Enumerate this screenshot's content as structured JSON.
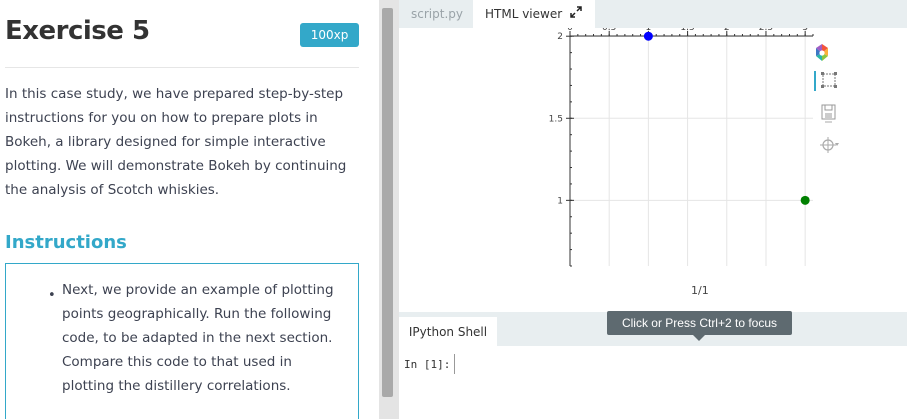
{
  "exercise": {
    "title": "Exercise 5",
    "xp": "100xp",
    "body": "In this case study, we have prepared step-by-step instructions for you on how to prepare plots in Bokeh, a library designed for simple interactive plotting. We will demonstrate Bokeh by continuing the analysis of Scotch whiskies."
  },
  "instructions": {
    "heading": "Instructions",
    "bullet": "•",
    "items": [
      "Next, we provide an example of plotting points geographically. Run the following code, to be adapted in the next section. Compare this code to that used in plotting the distillery correlations."
    ]
  },
  "tabs": {
    "script": "script.py",
    "html_viewer": "HTML viewer",
    "expand_icon": "expand-arrows-icon"
  },
  "viewer": {
    "page_indicator": "1/1"
  },
  "bokeh_toolbar": {
    "icons": [
      "bokeh-logo-icon",
      "box-zoom-icon",
      "save-icon",
      "hover-icon"
    ],
    "active_color": "#33a8c9"
  },
  "chart_data": {
    "type": "scatter",
    "x": [
      1,
      3
    ],
    "y": [
      2,
      1
    ],
    "colors": [
      "#0000ff",
      "#008000"
    ],
    "xlim": [
      0,
      3.1
    ],
    "ylim": [
      0.6,
      2.05
    ],
    "xticks": [
      "0",
      "0.5",
      "1",
      "1.5",
      "2",
      "2.5",
      "3"
    ],
    "yticks": [
      "1",
      "1.5",
      "2"
    ],
    "grid": true
  },
  "tooltip": "Click or Press Ctrl+2 to focus",
  "shell": {
    "tab": "IPython Shell",
    "prompt": "In [1]:"
  },
  "colors": {
    "accent": "#33a8c9",
    "text": "#3d4251",
    "tooltip_bg": "#5e6a70"
  }
}
